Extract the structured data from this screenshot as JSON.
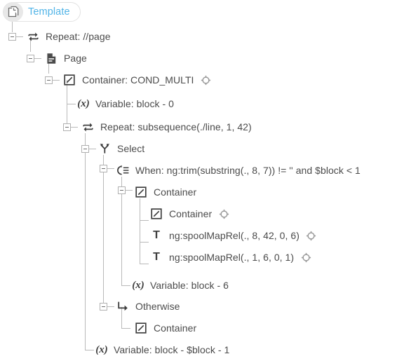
{
  "root": {
    "label": "Template",
    "icon": "copy-pages-icon",
    "accent_color": "#51b4e7"
  },
  "colors": {
    "text": "#4b4b4b",
    "accent": "#51b4e7",
    "tree_line": "#b9b9b9",
    "icon_dark": "#3d3d3d",
    "icon_muted": "#9a9a9a",
    "pill_bg": "#ffffff",
    "pill_border": "#e2e2e2",
    "icon_circle_bg": "#e8e8e8"
  },
  "nodes": [
    {
      "id": "n1",
      "label": "Repeat: //page",
      "icon": "repeat-icon",
      "depth": 1,
      "toggle": "collapse",
      "badge": ""
    },
    {
      "id": "n2",
      "label": "Page",
      "icon": "page-icon",
      "depth": 2,
      "toggle": "collapse",
      "badge": ""
    },
    {
      "id": "n3",
      "label": "Container: COND_MULTI",
      "icon": "container-icon",
      "depth": 3,
      "toggle": "collapse",
      "badge": "target-icon"
    },
    {
      "id": "n4",
      "label": "Variable: block - 0",
      "icon": "variable-icon",
      "depth": 4,
      "toggle": "none",
      "badge": ""
    },
    {
      "id": "n5",
      "label": "Repeat: subsequence(./line, 1, 42)",
      "icon": "repeat-icon",
      "depth": 4,
      "toggle": "collapse",
      "badge": ""
    },
    {
      "id": "n6",
      "label": "Select",
      "icon": "select-icon",
      "depth": 5,
      "toggle": "collapse",
      "badge": ""
    },
    {
      "id": "n7",
      "label": "When: ng:trim(substring(., 8, 7)) != '' and $block < 1",
      "icon": "when-icon",
      "depth": 6,
      "toggle": "collapse",
      "badge": ""
    },
    {
      "id": "n8",
      "label": "Container",
      "icon": "container-icon",
      "depth": 7,
      "toggle": "collapse",
      "badge": ""
    },
    {
      "id": "n9",
      "label": "Container",
      "icon": "container-icon",
      "depth": 8,
      "toggle": "none",
      "badge": "target-icon"
    },
    {
      "id": "n10",
      "label": "ng:spoolMapRel(., 8, 42, 0, 6)",
      "icon": "text-icon",
      "depth": 8,
      "toggle": "none",
      "badge": "target-icon"
    },
    {
      "id": "n11",
      "label": "ng:spoolMapRel(., 1, 6, 0, 1)",
      "icon": "text-icon",
      "depth": 8,
      "toggle": "none",
      "badge": "target-icon"
    },
    {
      "id": "n12",
      "label": "Variable: block - 6",
      "icon": "variable-icon",
      "depth": 7,
      "toggle": "none",
      "badge": ""
    },
    {
      "id": "n13",
      "label": "Otherwise",
      "icon": "otherwise-icon",
      "depth": 6,
      "toggle": "collapse",
      "badge": ""
    },
    {
      "id": "n14",
      "label": "Container",
      "icon": "container-icon",
      "depth": 7,
      "toggle": "none",
      "badge": ""
    },
    {
      "id": "n15",
      "label": "Variable: block - $block - 1",
      "icon": "variable-icon",
      "depth": 5,
      "toggle": "none",
      "badge": ""
    }
  ]
}
